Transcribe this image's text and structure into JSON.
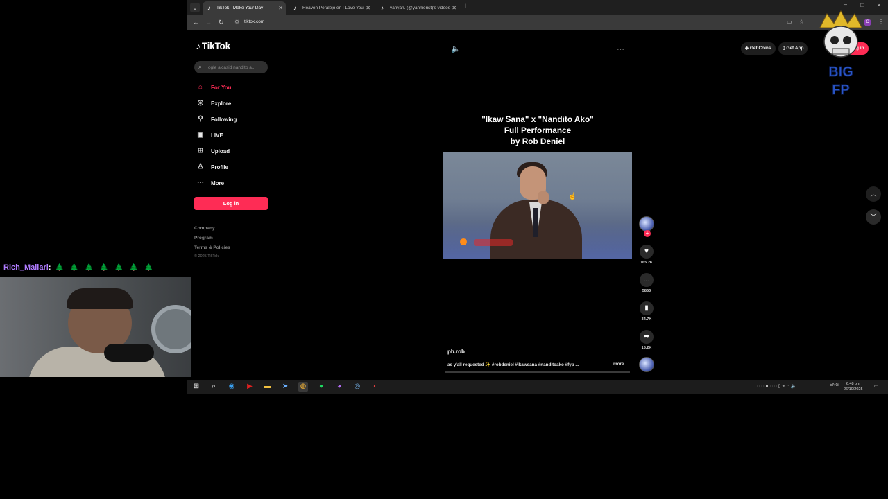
{
  "browser": {
    "tabs": [
      {
        "title": "TikTok - Make Your Day",
        "active": true
      },
      {
        "title": "Heaven Peralejo en I Love You",
        "active": false
      },
      {
        "title": "yanyan. (@yannierist)'s videos",
        "active": false
      }
    ],
    "url": "tiktok.com"
  },
  "tiktok": {
    "logo": "TikTok",
    "search_placeholder": "ogle alcasid nandito a...",
    "nav": [
      {
        "label": "For You",
        "icon": "home-icon",
        "active": true
      },
      {
        "label": "Explore",
        "icon": "compass-icon",
        "active": false
      },
      {
        "label": "Following",
        "icon": "following-icon",
        "active": false
      },
      {
        "label": "LIVE",
        "icon": "live-icon",
        "active": false
      },
      {
        "label": "Upload",
        "icon": "upload-icon",
        "active": false
      },
      {
        "label": "Profile",
        "icon": "profile-icon",
        "active": false
      },
      {
        "label": "More",
        "icon": "more-icon",
        "active": false
      }
    ],
    "login_button": "Log in",
    "footer": {
      "links": [
        "Company",
        "Program",
        "Terms & Policies"
      ],
      "copyright": "© 2025 TikTok"
    },
    "top_right": {
      "get_coins": "Get Coins",
      "get_app": "Get App",
      "login": "Log in"
    },
    "video": {
      "title_lines": [
        "\"Ikaw Sana\" x \"Nandito Ako\"",
        "Full Performance",
        "by Rob Deniel"
      ],
      "author": "pb.rob",
      "caption": "as y'all requested ✨ #robdeniel #ikawsana #nanditoako #fyp ...",
      "more": "more",
      "likes": "165.2K",
      "comments": "5853",
      "saves": "34.7K",
      "shares": "15.2K"
    }
  },
  "stream": {
    "chat_user": "Rich_Mallari",
    "chat_colon": ":",
    "chat_emotes": "🌲🌲🌲🌲🌲🌲🌲",
    "overlay_logo_text": "BIG FP"
  },
  "taskbar": {
    "language": "ENG",
    "time": "6:48 pm",
    "date": "26/10/2025"
  },
  "colors": {
    "tiktok_red": "#fe2c55",
    "chat_user": "#b07cff"
  }
}
